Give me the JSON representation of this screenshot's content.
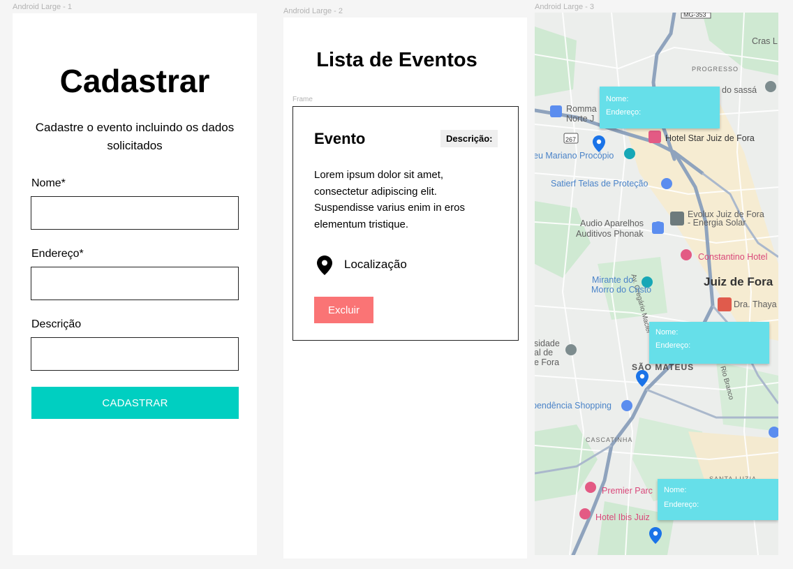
{
  "frames": {
    "frame1_label": "Android Large - 1",
    "frame2_label": "Android Large - 2",
    "frame3_label": "Android Large - 3"
  },
  "register": {
    "title": "Cadastrar",
    "subtitle": "Cadastre o evento incluindo os dados solicitados",
    "name_label": "Nome*",
    "address_label": "Endereço*",
    "description_label": "Descrição",
    "name_value": "",
    "address_value": "",
    "description_value": "",
    "submit_label": "CADASTRAR",
    "accent_color": "#00cfc1"
  },
  "events": {
    "title": "Lista de Eventos",
    "frame_caption": "Frame",
    "card": {
      "title": "Evento",
      "description_badge": "Descrição:",
      "body": "Lorem ipsum dolor sit amet, consectetur adipiscing elit. Suspendisse varius enim in eros elementum tristique.",
      "location_icon": "location-pin-icon",
      "location_label": "Localização",
      "delete_label": "Excluir",
      "delete_color": "#fa7475"
    }
  },
  "map": {
    "labels": {
      "road_sign": "MG-353",
      "cras": "Cras L",
      "progresso": "PROGRESSO",
      "sassa": "do sassá",
      "romma": "Romma",
      "norte_j": "Norte J",
      "hotel_star": "Hotel Star Juiz de Fora",
      "road_267": "267",
      "mariano": "eu Mariano Procópio",
      "satierf": "Satierf Telas de Proteção",
      "evolux": "Evolux Juiz de Fora",
      "energia": "- Energia Solar",
      "audio1": "Audio Aparelhos",
      "audio2": "Auditivos Phonak",
      "oregario": "Av. Oregário Maciel",
      "constantino": "Constantino Hotel",
      "mirante1": "Mirante do",
      "mirante2": "Morro do Cristo",
      "juiz": "Juiz de Fora",
      "thaya": "Dra. Thaya",
      "sidade1": "sidade",
      "sidade2": "al de",
      "sidade3": "e Fora",
      "sao_mateus": "SÃO MATEUS",
      "rio_branco": "Rio Branco",
      "shopping": "pendência Shopping",
      "cascatinha": "CASCATINHA",
      "santa_luzia": "SANTA LUZIA",
      "premier": "Premier Parc",
      "ibis": "Hotel Ibis Juiz"
    },
    "popups": [
      {
        "name_label": "Nome:",
        "address_label": "Endereço:"
      },
      {
        "name_label": "Nome:",
        "address_label": "Endereço:"
      },
      {
        "name_label": "Nome:",
        "address_label": "Endereço:"
      }
    ],
    "popup_color": "#66dfe9",
    "marker_color": "#1a73e8"
  }
}
